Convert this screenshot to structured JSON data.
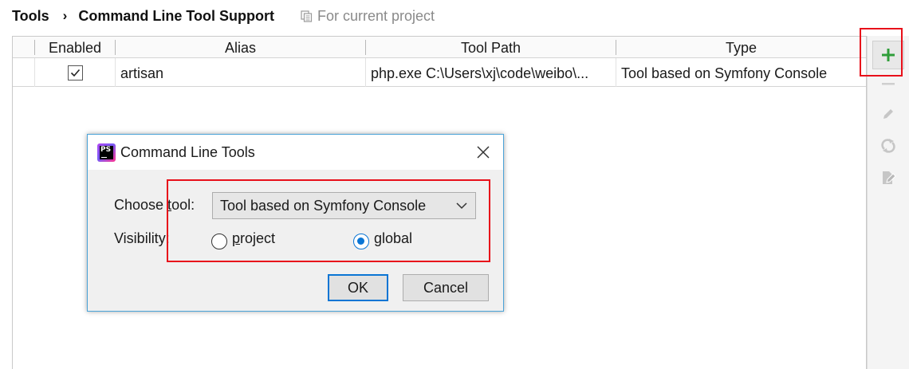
{
  "breadcrumb": {
    "parent": "Tools",
    "separator": "›",
    "current": "Command Line Tool Support",
    "scope_icon": "copy-icon",
    "scope_label": "For current project"
  },
  "table": {
    "columns": [
      "Enabled",
      "Alias",
      "Tool Path",
      "Type"
    ],
    "rows": [
      {
        "enabled": true,
        "alias": "artisan",
        "tool_path": "php.exe C:\\Users\\xj\\code\\weibo\\...",
        "type": "Tool based on Symfony Console"
      }
    ]
  },
  "toolbar": {
    "buttons": [
      {
        "icon": "plus-icon",
        "enabled": true,
        "color": "#2f9e3a"
      },
      {
        "icon": "minus-icon",
        "enabled": false
      },
      {
        "icon": "pencil-icon",
        "enabled": false
      },
      {
        "icon": "refresh-icon",
        "enabled": false
      },
      {
        "icon": "export-icon",
        "enabled": false
      }
    ]
  },
  "dialog": {
    "title": "Command Line Tools",
    "app_icon": "phpstorm-logo",
    "app_icon_text": "PS",
    "choose_tool_label_pre": "Choose ",
    "choose_tool_label_ul": "t",
    "choose_tool_label_post": "ool:",
    "selected_tool": "Tool based on Symfony Console",
    "visibility_label": "Visibility:",
    "visibility_options": [
      {
        "mnemonic": "p",
        "rest": "roject",
        "selected": false
      },
      {
        "mnemonic": "g",
        "rest": "lobal",
        "selected": true
      }
    ],
    "ok_label": "OK",
    "cancel_label": "Cancel"
  },
  "colors": {
    "highlight": "#e8101a",
    "accent": "#0a75d4",
    "dialog_border": "#4aa3d8"
  }
}
